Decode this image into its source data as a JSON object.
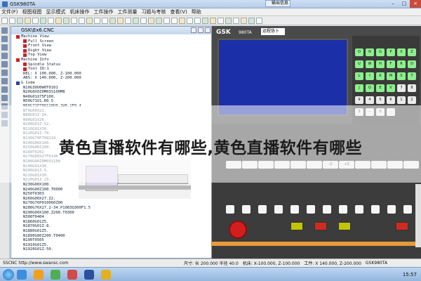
{
  "window": {
    "title": "GSK980TA",
    "controls": [
      "–",
      "□",
      "×"
    ]
  },
  "message_tab": "输出信息",
  "menu": [
    "文件(F)",
    "视图视图",
    "显示模式",
    "机床操作",
    "工件操作",
    "工件测量",
    "习题与考核",
    "查看(V)",
    "帮助"
  ],
  "document": {
    "title": "GSK\\Ex6.CNC",
    "tree": [
      {
        "text": "Machine View",
        "indent": 1,
        "marker": "#cc2222"
      },
      {
        "text": "Full Screen",
        "indent": 3,
        "marker": "#cc2222"
      },
      {
        "text": "Front View",
        "indent": 3,
        "marker": "#cc2222"
      },
      {
        "text": "Right View",
        "indent": 3,
        "marker": "#cc2222"
      },
      {
        "text": "Top View",
        "indent": 3,
        "marker": "#cc2222"
      },
      {
        "text": "Machine Info",
        "indent": 1,
        "marker": "#cc2222"
      },
      {
        "text": "Spindle Status",
        "indent": 3,
        "marker": "#cc2222"
      },
      {
        "text": "Tool ID:1",
        "indent": 3,
        "marker": "#cc2222"
      },
      {
        "text": "REL: X 100.000, Z-100.000",
        "indent": 3,
        "marker": ""
      },
      {
        "text": "ABS: X 140.000, Z-200.000",
        "indent": 3,
        "marker": ""
      },
      {
        "text": "G Code",
        "indent": 1,
        "marker": "#2244aa"
      },
      {
        "text": "N10G30U0W0T0101",
        "indent": 3,
        "marker": ""
      },
      {
        "text": "N20G0X0Z0M03S100M8",
        "indent": 3,
        "marker": ""
      },
      {
        "text": "N40G01X75F100.",
        "indent": 3,
        "marker": ""
      },
      {
        "text": "N50G71U1.R0.5",
        "indent": 3,
        "marker": ""
      },
      {
        "text": "N60G71P70Q110U0.1W0.1F0.4",
        "indent": 3,
        "marker": ""
      },
      {
        "text": "N70G00X22.",
        "indent": 3,
        "marker": ""
      },
      {
        "text": "N80G01Z-34.",
        "indent": 3,
        "marker": ""
      },
      {
        "text": "N90G01X26.",
        "indent": 3,
        "marker": ""
      },
      {
        "text": "N100G01Z-52.",
        "indent": 3,
        "marker": ""
      },
      {
        "text": "N110G01X30.",
        "indent": 3,
        "marker": ""
      },
      {
        "text": "N120G01Z-70.",
        "indent": 3,
        "marker": ""
      },
      {
        "text": "N130G70P70Q110",
        "indent": 3,
        "marker": ""
      },
      {
        "text": "N140G00X100.",
        "indent": 3,
        "marker": ""
      },
      {
        "text": "N150G00Z100.",
        "indent": 3,
        "marker": ""
      },
      {
        "text": "N160T0202",
        "indent": 3,
        "marker": ""
      },
      {
        "text": "N170G00X27F0140",
        "indent": 3,
        "marker": ""
      },
      {
        "text": "N180G00Z0M03S100",
        "indent": 3,
        "marker": ""
      },
      {
        "text": "N190G01X30.",
        "indent": 3,
        "marker": ""
      },
      {
        "text": "N200G01Z-5.",
        "indent": 3,
        "marker": ""
      },
      {
        "text": "N210G01X30.",
        "indent": 3,
        "marker": ""
      },
      {
        "text": "N220G01Z-25.",
        "indent": 3,
        "marker": ""
      },
      {
        "text": "N230G00X100.",
        "indent": 3,
        "marker": ""
      },
      {
        "text": "N240G00Z100.T0000",
        "indent": 3,
        "marker": ""
      },
      {
        "text": "N250T0303",
        "indent": 3,
        "marker": ""
      },
      {
        "text": "N260G00X27.Z2.",
        "indent": 3,
        "marker": ""
      },
      {
        "text": "N270G76P010060Z00",
        "indent": 3,
        "marker": ""
      },
      {
        "text": "N280G76X27.2-34.P1083Q300F1.5",
        "indent": 3,
        "marker": ""
      },
      {
        "text": "N290G00X100.Z200.T0300",
        "indent": 3,
        "marker": ""
      },
      {
        "text": "N300T0404",
        "indent": 3,
        "marker": ""
      },
      {
        "text": "N1860G01Z5.",
        "indent": 3,
        "marker": ""
      },
      {
        "text": "N1870G01Z-8.",
        "indent": 3,
        "marker": ""
      },
      {
        "text": "N1880G01Z5.",
        "indent": 3,
        "marker": ""
      },
      {
        "text": "N1890G00Z200.T0400",
        "indent": 3,
        "marker": ""
      },
      {
        "text": "N190T0505",
        "indent": 3,
        "marker": ""
      },
      {
        "text": "N1910G01Z5.",
        "indent": 3,
        "marker": ""
      },
      {
        "text": "N1920G01Z-50.",
        "indent": 3,
        "marker": ""
      }
    ]
  },
  "panel": {
    "brand": "GSK",
    "model": "980TA",
    "mode_label": "运程协卜",
    "keypad": [
      "O",
      "N",
      "G",
      "P",
      "X",
      "Z",
      "U",
      "W",
      "H",
      "F",
      "R",
      "D",
      "L",
      "I",
      "K",
      "M",
      "S",
      "T",
      "J",
      "Q",
      "E",
      "V",
      "7",
      "8",
      "9",
      "4",
      "5",
      "6",
      "1",
      "2",
      "3",
      "-",
      "0",
      "."
    ],
    "softkeys": [
      "",
      "",
      "",
      "",
      "",
      "",
      "-Z",
      "+Z",
      "",
      "",
      "",
      ""
    ],
    "controls": [
      "",
      "",
      "",
      "",
      "",
      "",
      "",
      "",
      "",
      "",
      "",
      ""
    ]
  },
  "status": {
    "left": "SSCNC http://www.swansc.com",
    "items": [
      "尺寸: 长 200.000 半径 40.0",
      "机床: X-100.000, Z-100.000",
      "工件: X 140.000, Z-200.000",
      "GSK980TA"
    ]
  },
  "watermark": "黄色直播软件有哪些,黄色直播软件有哪些",
  "taskbar": {
    "time": "15:57"
  },
  "colors": {
    "screen": "#1b2fa8",
    "estop": "#d41e1e",
    "accent": "#e79a3a"
  }
}
